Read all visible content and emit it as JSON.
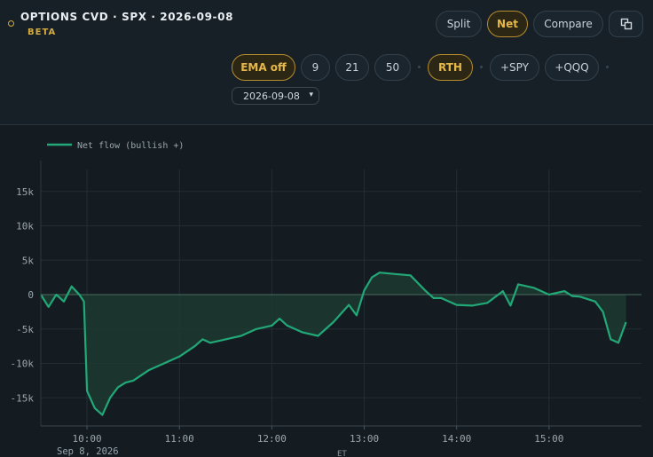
{
  "header": {
    "title": "OPTIONS CVD · SPX · 2026-09-08",
    "badge": "BETA"
  },
  "view_toggle": {
    "split": "Split",
    "net": "Net",
    "compare": "Compare",
    "active": "Net"
  },
  "toolbar": {
    "ema_off": "EMA off",
    "ema_9": "9",
    "ema_21": "21",
    "ema_50": "50",
    "rth": "RTH",
    "add_spy": "+SPY",
    "add_qqq": "+QQQ",
    "date_value": "2026-09-08"
  },
  "colors": {
    "accent": "#d6ab3f",
    "line": "#22a877",
    "fill": "#1c3a30"
  },
  "icons": {
    "status": "circle-outline-icon",
    "popout": "popout-icon",
    "chevron": "chevron-down-icon"
  },
  "chart_data": {
    "type": "line",
    "legend": "Net flow (bullish +)",
    "legend_position": "top-left",
    "grid": true,
    "y_ticks": [
      "15k",
      "10k",
      "5k",
      "0",
      "-5k",
      "-10k",
      "-15k"
    ],
    "y_tick_values": [
      15000,
      10000,
      5000,
      0,
      -5000,
      -10000,
      -15000
    ],
    "ylim": [
      -19000,
      19000
    ],
    "x_ticks": [
      "10:00",
      "11:00",
      "12:00",
      "13:00",
      "14:00",
      "15:00"
    ],
    "x_date_label": "Sep 8, 2026",
    "x_unit": "ET",
    "series": [
      {
        "name": "Net flow (bullish +)",
        "x": [
          "09:30",
          "09:35",
          "09:40",
          "09:45",
          "09:50",
          "09:55",
          "09:58",
          "10:00",
          "10:05",
          "10:10",
          "10:15",
          "10:20",
          "10:25",
          "10:30",
          "10:40",
          "10:50",
          "11:00",
          "11:10",
          "11:15",
          "11:20",
          "11:30",
          "11:40",
          "11:50",
          "12:00",
          "12:05",
          "12:10",
          "12:20",
          "12:30",
          "12:40",
          "12:50",
          "12:55",
          "13:00",
          "13:05",
          "13:10",
          "13:20",
          "13:30",
          "13:40",
          "13:45",
          "13:50",
          "14:00",
          "14:10",
          "14:20",
          "14:30",
          "14:35",
          "14:40",
          "14:50",
          "15:00",
          "15:10",
          "15:15",
          "15:20",
          "15:30",
          "15:35",
          "15:40",
          "15:45",
          "15:50"
        ],
        "y": [
          0,
          -1800,
          0,
          -1000,
          1200,
          0,
          -1000,
          -14000,
          -16500,
          -17500,
          -15000,
          -13500,
          -12800,
          -12500,
          -11000,
          -10000,
          -9000,
          -7500,
          -6500,
          -7000,
          -6500,
          -6000,
          -5000,
          -4500,
          -3500,
          -4500,
          -5500,
          -6000,
          -4000,
          -1500,
          -3000,
          600,
          2500,
          3200,
          3000,
          2800,
          500,
          -500,
          -500,
          -1500,
          -1600,
          -1200,
          500,
          -1600,
          1500,
          1000,
          0,
          500,
          -200,
          -300,
          -1000,
          -2500,
          -6500,
          -7000,
          -4000
        ]
      }
    ]
  }
}
